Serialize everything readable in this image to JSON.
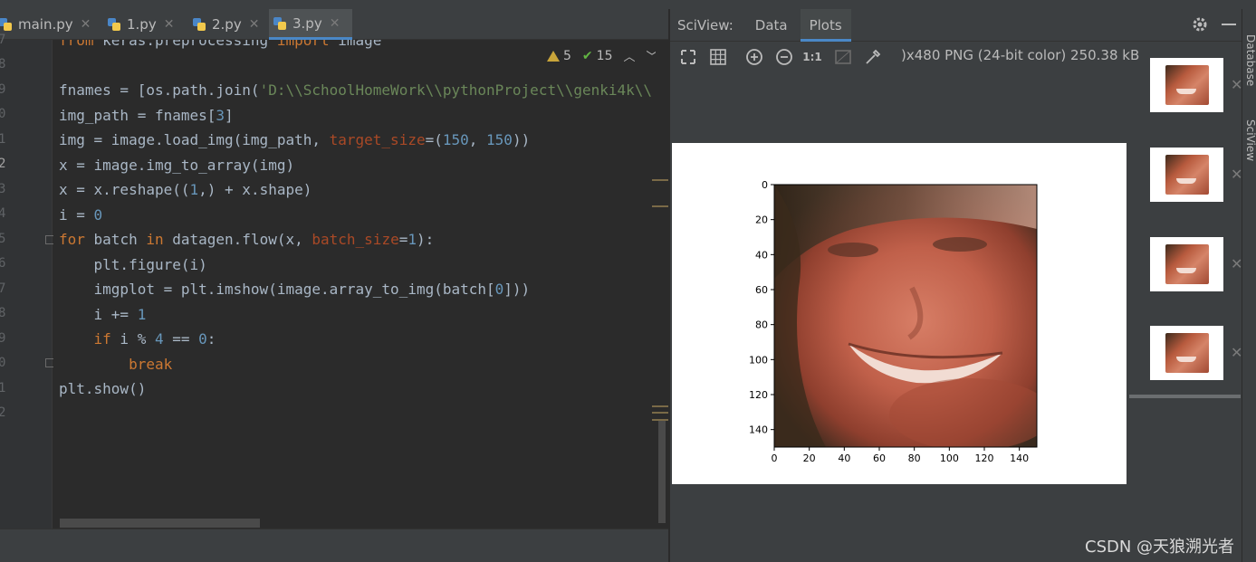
{
  "editor": {
    "tabs": [
      {
        "label": "main.py",
        "active": false
      },
      {
        "label": "1.py",
        "active": false
      },
      {
        "label": "2.py",
        "active": false
      },
      {
        "label": "3.py",
        "active": true
      }
    ],
    "inspections": {
      "warnings": "5",
      "weak_warnings": "15"
    },
    "line_numbers": [
      "7",
      "8",
      "9",
      "0",
      "1",
      "2",
      "3",
      "4",
      "5",
      "6",
      "7",
      "8",
      "9",
      "0",
      "1",
      "2"
    ],
    "code_lines": [
      "from keras.preprocessing import image",
      "",
      "fnames = [os.path.join('D:\\\\SchoolHomeWork\\\\pythonProject\\\\genki4k\\\\",
      "img_path = fnames[3]",
      "img = image.load_img(img_path, target_size=(150, 150))",
      "x = image.img_to_array(img)",
      "x = x.reshape((1,) + x.shape)",
      "i = 0",
      "for batch in datagen.flow(x, batch_size=1):",
      "    plt.figure(i)",
      "    imgplot = plt.imshow(image.array_to_img(batch[0]))",
      "    i += 1",
      "    if i % 4 == 0:",
      "        break",
      "plt.show()",
      ""
    ]
  },
  "sciview": {
    "title": "SciView:",
    "tabs": [
      "Data",
      "Plots"
    ],
    "active_tab": "Plots",
    "image_info": ")x480 PNG (24-bit color) 250.38 kB",
    "zoom_label": "1:1",
    "toolbar_icons": [
      "fit-icon",
      "grid-icon",
      "zoom-in-icon",
      "zoom-out-icon",
      "actual-size-icon",
      "frame-icon",
      "color-picker-icon"
    ],
    "thumbnail_count": 4
  },
  "right_bar": {
    "database": "Database",
    "sciview": "SciView"
  },
  "chart_data": {
    "type": "heatmap",
    "title": "",
    "xlabel": "",
    "ylabel": "",
    "x_ticks": [
      0,
      20,
      40,
      60,
      80,
      100,
      120,
      140
    ],
    "y_ticks": [
      0,
      20,
      40,
      60,
      80,
      100,
      120,
      140
    ],
    "xlim": [
      0,
      150
    ],
    "ylim": [
      150,
      0
    ],
    "image_size": [
      150,
      150
    ]
  },
  "watermark": "CSDN @天狼溯光者"
}
